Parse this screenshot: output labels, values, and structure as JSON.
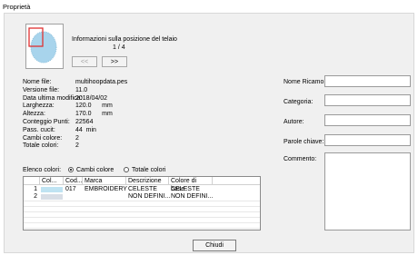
{
  "window": {
    "title": "Proprietà"
  },
  "preview": {
    "info": "Informazioni sulla posizione del telaio",
    "page": "1 / 4",
    "prev_label": "<<",
    "next_label": ">>"
  },
  "info_rows": [
    {
      "label": "Nome file:",
      "value": "multihoopdata.pes"
    },
    {
      "label": "Versione file:",
      "value": "11.0"
    },
    {
      "label": "Data ultima modifica:",
      "value": "2018/04/02"
    },
    {
      "label": "Larghezza:",
      "value": "120.0      mm"
    },
    {
      "label": "Altezza:",
      "value": "170.0      mm"
    },
    {
      "label": "Conteggio Punti:",
      "value": "22564"
    },
    {
      "label": "Pass. cucit:",
      "value": "44  min"
    },
    {
      "label": "Cambi colore:",
      "value": "2"
    },
    {
      "label": "Totale colori:",
      "value": "2"
    }
  ],
  "color_list": {
    "label": "Elenco colori:",
    "option_changes": "Cambi colore",
    "option_total": "Totale colori",
    "selected": "Cambi colore"
  },
  "table": {
    "headers": [
      "",
      "Col...",
      "Cod...",
      "Marca",
      "Descrizione",
      "Colore di base"
    ],
    "rows": [
      {
        "n": "1",
        "color": "#bfe3f2",
        "code": "017",
        "brand": "EMBROIDERY",
        "desc": "CELESTE",
        "base": "CELESTE"
      },
      {
        "n": "2",
        "color": "#d8dee6",
        "code": "",
        "brand": "",
        "desc": "NON DEFINI...",
        "base": "NON DEFINI..."
      }
    ]
  },
  "right_fields": {
    "name": "Nome Ricamo:",
    "category": "Categoria:",
    "author": "Autore:",
    "keywords": "Parole chiave:",
    "comment": "Commento:"
  },
  "close_label": "Chiudi",
  "colors": {
    "hoop_highlight": "#e03030",
    "embroidery": "#a8d4ec"
  }
}
